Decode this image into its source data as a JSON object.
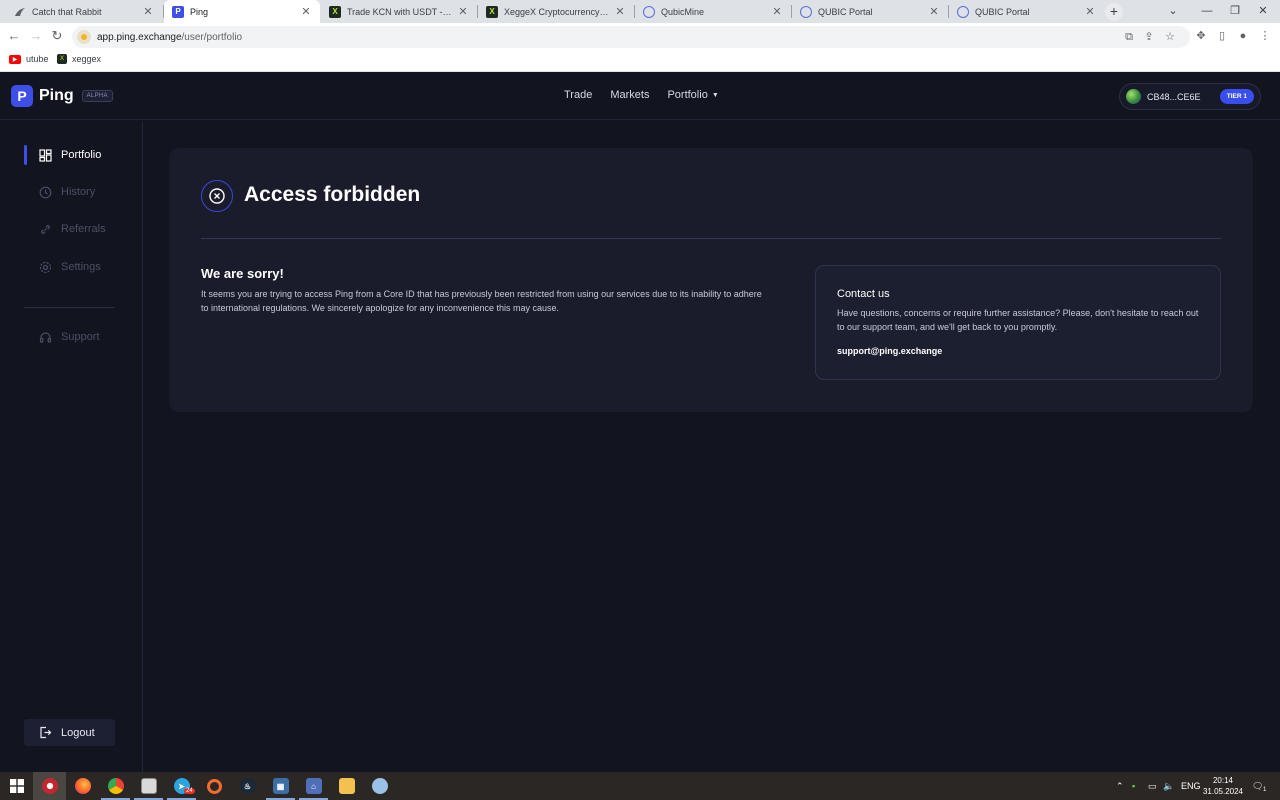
{
  "browser": {
    "tabs": [
      {
        "title": "Catch that Rabbit",
        "active": false,
        "favicon": "rabbit-icon"
      },
      {
        "title": "Ping",
        "active": true,
        "favicon": "ping-logo-icon"
      },
      {
        "title": "Trade KCN with USDT - XeggeX",
        "active": false,
        "favicon": "xeggex-icon"
      },
      {
        "title": "XeggeX Cryptocurrency Exchange",
        "active": false,
        "favicon": "xeggex-icon"
      },
      {
        "title": "QubicMine",
        "active": false,
        "favicon": "qubic-icon"
      },
      {
        "title": "QUBIC Portal",
        "active": false,
        "favicon": "qubic-icon"
      },
      {
        "title": "QUBIC Portal",
        "active": false,
        "favicon": "qubic-icon"
      }
    ],
    "url_host": "app.ping.exchange",
    "url_path": "/user/portfolio",
    "bookmarks": [
      {
        "label": "utube",
        "icon": "youtube-icon"
      },
      {
        "label": "xeggex",
        "icon": "xeggex-icon"
      }
    ]
  },
  "app": {
    "brand": "Ping",
    "brand_badge": "ALPHA",
    "brand_color": "#3e4ee8",
    "nav": {
      "trade": "Trade",
      "markets": "Markets",
      "portfolio": "Portfolio"
    },
    "wallet": {
      "address": "CB48...CE6E",
      "tier": "TIER 1"
    },
    "sidebar": {
      "portfolio": "Portfolio",
      "history": "History",
      "referrals": "Referrals",
      "settings": "Settings",
      "support": "Support",
      "logout": "Logout"
    },
    "error": {
      "title": "Access forbidden",
      "heading": "We are sorry!",
      "message": "It seems you are trying to access Ping from a Core ID that has previously been restricted from using our services due to its inability to adhere to international regulations. We sincerely apologize for any inconvenience this may cause.",
      "contact_title": "Contact us",
      "contact_text": "Have questions, concerns or require further assistance? Please, don't hesitate to reach out to our support team, and we'll get back to you promptly.",
      "contact_email": "support@ping.exchange"
    }
  },
  "taskbar": {
    "language": "ENG",
    "time": "20:14",
    "date": "31.05.2024",
    "notification_count": "1",
    "telegram_badge": "24"
  }
}
